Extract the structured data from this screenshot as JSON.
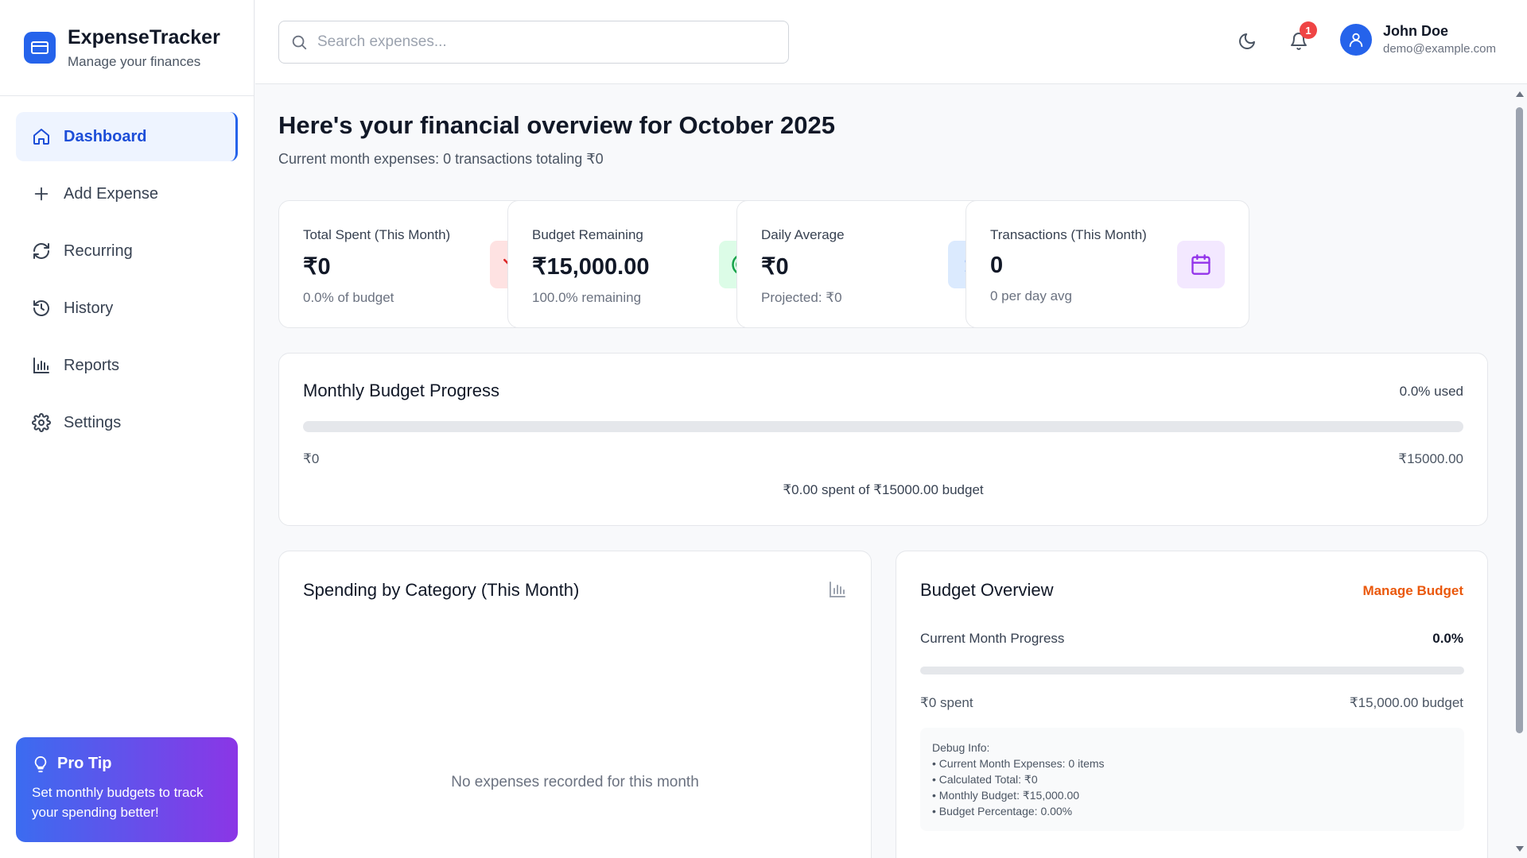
{
  "brand": {
    "title": "ExpenseTracker",
    "subtitle": "Manage your finances",
    "icon": "credit-card-icon",
    "color": "#2563eb"
  },
  "sidebar": {
    "items": [
      {
        "label": "Dashboard",
        "icon": "home-icon",
        "active": true
      },
      {
        "label": "Add Expense",
        "icon": "plus-icon",
        "active": false
      },
      {
        "label": "Recurring",
        "icon": "refresh-icon",
        "active": false
      },
      {
        "label": "History",
        "icon": "history-icon",
        "active": false
      },
      {
        "label": "Reports",
        "icon": "bar-chart-icon",
        "active": false
      },
      {
        "label": "Settings",
        "icon": "gear-icon",
        "active": false
      }
    ],
    "protip": {
      "title": "Pro Tip",
      "text": "Set monthly budgets to track your spending better!",
      "icon": "lightbulb-icon"
    }
  },
  "header": {
    "search": {
      "placeholder": "Search expenses...",
      "value": ""
    },
    "notification_count": "1",
    "user": {
      "name": "John Doe",
      "email": "demo@example.com"
    }
  },
  "main": {
    "greeting": "Here's your financial overview for October 2025",
    "subline": "Current month expenses: 0 transactions totaling ₹0",
    "stats": [
      {
        "label": "Total Spent (This Month)",
        "value": "₹0",
        "sub": "0.0% of budget",
        "icon": "trending-down-icon",
        "accent": "#dc2626",
        "bg": "#fee2e2"
      },
      {
        "label": "Budget Remaining",
        "value": "₹15,000.00",
        "sub": "100.0% remaining",
        "icon": "target-icon",
        "accent": "#16a34a",
        "bg": "#dcfce7"
      },
      {
        "label": "Daily Average",
        "value": "₹0",
        "sub": "Projected: ₹0",
        "icon": "dollar-icon",
        "accent": "#2563eb",
        "bg": "#dbeafe"
      },
      {
        "label": "Transactions (This Month)",
        "value": "0",
        "sub": "0 per day avg",
        "icon": "calendar-icon",
        "accent": "#9333ea",
        "bg": "#f3e8ff"
      }
    ],
    "budget_progress": {
      "title": "Monthly Budget Progress",
      "used_label": "0.0% used",
      "fill_fraction": 0,
      "min_label": "₹0",
      "max_label": "₹15000.00",
      "summary": "₹0.00 spent of ₹15000.00 budget"
    },
    "category": {
      "title": "Spending by Category (This Month)",
      "empty_text": "No expenses recorded for this month"
    },
    "budget_overview": {
      "title": "Budget Overview",
      "manage_label": "Manage Budget",
      "progress_label": "Current Month Progress",
      "progress_value": "0.0%",
      "fill_fraction": 0,
      "spent_label": "₹0 spent",
      "budget_label": "₹15,000.00 budget",
      "debug_title": "Debug Info:",
      "debug_lines": [
        "• Current Month Expenses: 0 items",
        "• Calculated Total: ₹0",
        "• Monthly Budget: ₹15,000.00",
        "• Budget Percentage: 0.00%"
      ]
    }
  }
}
